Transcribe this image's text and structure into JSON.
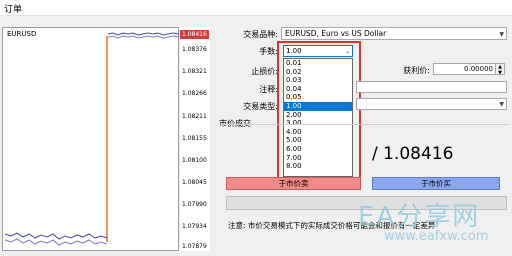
{
  "window": {
    "title": "订单"
  },
  "chart": {
    "symbol": "EURUSD",
    "current_price_tag": "1.08416",
    "price_ticks": [
      "1.08376",
      "1.08321",
      "1.08266",
      "1.08211",
      "1.08155",
      "1.08100",
      "1.08045",
      "1.07990",
      "1.07934",
      "1.07879"
    ]
  },
  "form": {
    "symbol_label": "交易品种:",
    "symbol_value": "EURUSD, Euro vs US Dollar",
    "volume_label": "手数:",
    "volume_value": "1.00",
    "volume_options": [
      "0.01",
      "0.02",
      "0.03",
      "0.04",
      "0.05",
      "1.00",
      "2.00",
      "3.00",
      "4.00",
      "5.00",
      "6.00",
      "7.00",
      "8.00"
    ],
    "volume_selected_index": 5,
    "sl_label": "止损价:",
    "tp_label": "获利价:",
    "tp_value": "0.00000",
    "comment_label": "注释:",
    "type_label": "交易类型:",
    "group_label": "市价成交"
  },
  "quote": {
    "display": "/ 1.08416"
  },
  "buttons": {
    "sell": "于市价卖",
    "buy": "于市价买"
  },
  "note": "注意: 市价交易模式下的实际成交价格可能会和报价有一定差异",
  "watermark": {
    "text": "EA分享网",
    "url": "www.eafxw.com"
  },
  "colors": {
    "highlight_border": "#e0302a",
    "sell": "#f28a8a",
    "buy": "#8aa8f2",
    "selection": "#0078d7"
  }
}
